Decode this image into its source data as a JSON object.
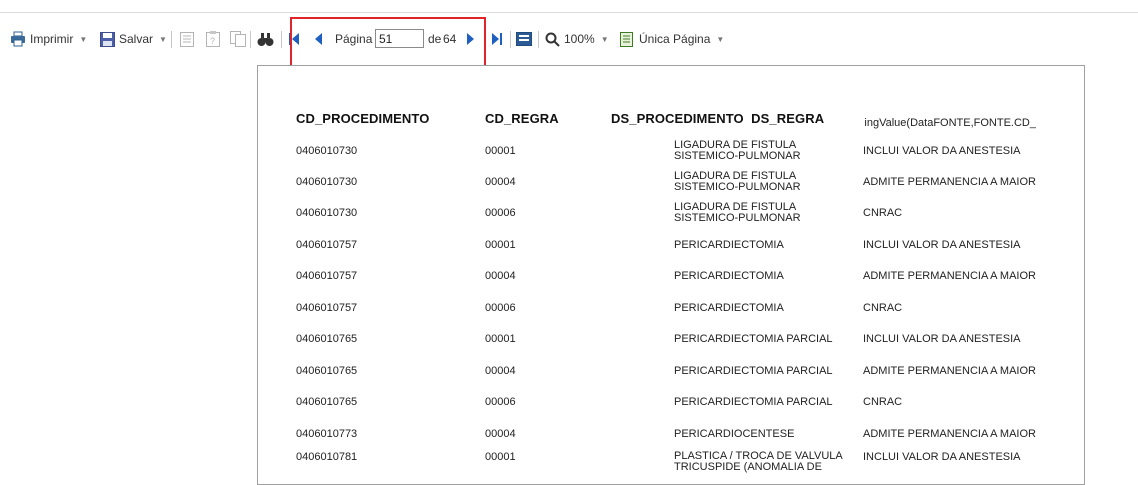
{
  "toolbar": {
    "print_label": "Imprimir",
    "save_label": "Salvar",
    "page_label": "Página",
    "page_current": "51",
    "page_of_label": "de",
    "page_total": "64",
    "zoom_label": "100%",
    "view_mode_label": "Única Página"
  },
  "report": {
    "headers": {
      "cd_procedimento": "CD_PROCEDIMENTO",
      "cd_regra": "CD_REGRA",
      "ds_procedimento_ds_regra": "DS_PROCEDIMENTO  DS_REGRA",
      "running_expr": "RunningValue(DataFONTE,FONTE.CD_"
    },
    "rows": [
      {
        "cd_procedimento": "0406010730",
        "cd_regra": "00001",
        "ds_procedimento": "LIGADURA DE FISTULA SISTEMICO-PULMONAR",
        "ds_regra": "INCLUI VALOR DA ANESTESIA"
      },
      {
        "cd_procedimento": "0406010730",
        "cd_regra": "00004",
        "ds_procedimento": "LIGADURA DE FISTULA SISTEMICO-PULMONAR",
        "ds_regra": "ADMITE PERMANENCIA A MAIOR"
      },
      {
        "cd_procedimento": "0406010730",
        "cd_regra": "00006",
        "ds_procedimento": "LIGADURA DE FISTULA SISTEMICO-PULMONAR",
        "ds_regra": "CNRAC"
      },
      {
        "cd_procedimento": "0406010757",
        "cd_regra": "00001",
        "ds_procedimento": "PERICARDIECTOMIA",
        "ds_regra": "INCLUI VALOR DA ANESTESIA"
      },
      {
        "cd_procedimento": "0406010757",
        "cd_regra": "00004",
        "ds_procedimento": "PERICARDIECTOMIA",
        "ds_regra": "ADMITE PERMANENCIA A MAIOR"
      },
      {
        "cd_procedimento": "0406010757",
        "cd_regra": "00006",
        "ds_procedimento": "PERICARDIECTOMIA",
        "ds_regra": "CNRAC"
      },
      {
        "cd_procedimento": "0406010765",
        "cd_regra": "00001",
        "ds_procedimento": "PERICARDIECTOMIA PARCIAL",
        "ds_regra": "INCLUI VALOR DA ANESTESIA"
      },
      {
        "cd_procedimento": "0406010765",
        "cd_regra": "00004",
        "ds_procedimento": "PERICARDIECTOMIA PARCIAL",
        "ds_regra": "ADMITE PERMANENCIA A MAIOR"
      },
      {
        "cd_procedimento": "0406010765",
        "cd_regra": "00006",
        "ds_procedimento": "PERICARDIECTOMIA PARCIAL",
        "ds_regra": "CNRAC"
      },
      {
        "cd_procedimento": "0406010773",
        "cd_regra": "00004",
        "ds_procedimento": "PERICARDIOCENTESE",
        "ds_regra": "ADMITE PERMANENCIA A MAIOR"
      },
      {
        "cd_procedimento": "0406010781",
        "cd_regra": "00001",
        "ds_procedimento": "PLASTICA / TROCA DE VALVULA TRICUSPIDE (ANOMALIA DE",
        "ds_regra": "INCLUI VALOR DA ANESTESIA"
      }
    ]
  }
}
